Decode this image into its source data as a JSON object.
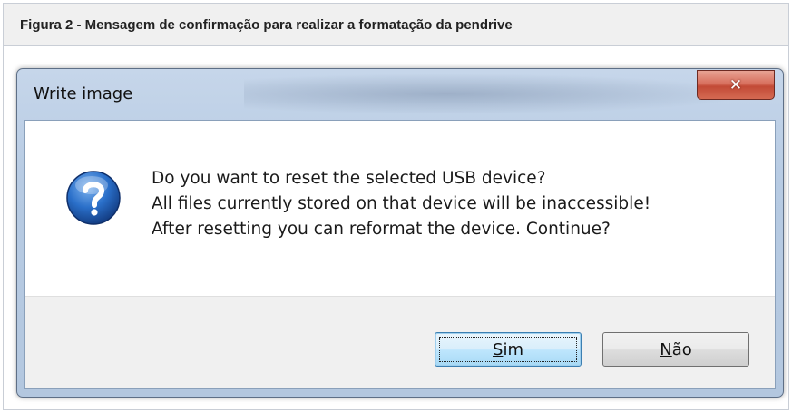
{
  "caption": "Figura 2 - Mensagem de confirmação para realizar a formatação da pendrive",
  "window": {
    "title": "Write image",
    "close_glyph": "✕"
  },
  "dialog": {
    "icon": "question-icon",
    "message_lines": [
      "Do you want to reset the selected USB device?",
      "All files currently stored on that device will be inaccessible!",
      "After resetting you can reformat the device. Continue?"
    ]
  },
  "buttons": {
    "yes": {
      "accel": "S",
      "rest": "im"
    },
    "no": {
      "accel": "N",
      "rest": "ão"
    }
  },
  "colors": {
    "default_button": "#bee6fd",
    "close_button": "#c24a36",
    "question_icon": "#1f5fb4"
  }
}
